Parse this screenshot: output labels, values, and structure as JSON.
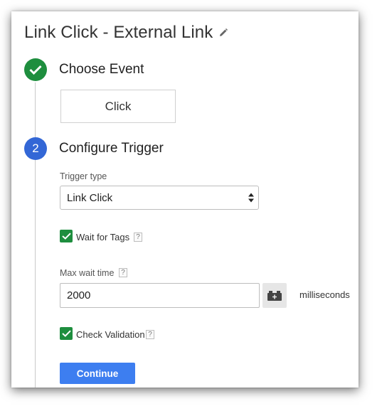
{
  "header": {
    "title": "Link Click - External Link",
    "edit_icon": "pencil-icon"
  },
  "steps": [
    {
      "status": "complete",
      "marker_icon": "checkmark-icon",
      "title": "Choose Event",
      "event_value": "Click"
    },
    {
      "status": "active",
      "number": "2",
      "title": "Configure Trigger"
    }
  ],
  "trigger": {
    "type_label": "Trigger type",
    "type_value": "Link Click",
    "wait_for_tags": {
      "label": "Wait for Tags",
      "checked": true,
      "help": "?"
    },
    "max_wait": {
      "label": "Max wait time",
      "help": "?",
      "value": "2000",
      "unit": "milliseconds",
      "variable_icon": "variable-picker-icon"
    },
    "check_validation": {
      "label": "Check Validation",
      "checked": true,
      "help": "?"
    }
  },
  "actions": {
    "continue_label": "Continue"
  },
  "colors": {
    "success": "#1e8e3e",
    "active_step": "#3367d6",
    "primary_button": "#3d7ef0"
  }
}
